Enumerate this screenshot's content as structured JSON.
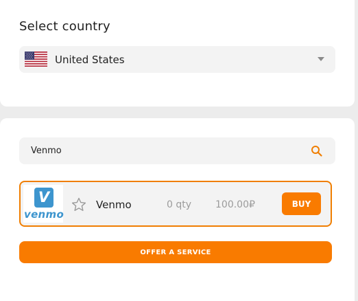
{
  "country_section": {
    "title": "Select country",
    "selected_country": "United States",
    "flag_icon": "us-flag-icon"
  },
  "search": {
    "value": "Venmo",
    "icon": "search-icon"
  },
  "service": {
    "logo_letter": "V",
    "logo_wordmark": "venmo",
    "name": "Venmo",
    "qty": "0 qty",
    "price": "100.00₽",
    "buy_label": "BUY",
    "favorite_icon": "star-outline-icon"
  },
  "offer_button_label": "OFFER A SERVICE",
  "colors": {
    "accent": "#f97b00",
    "venmo_blue": "#3d95ce"
  }
}
